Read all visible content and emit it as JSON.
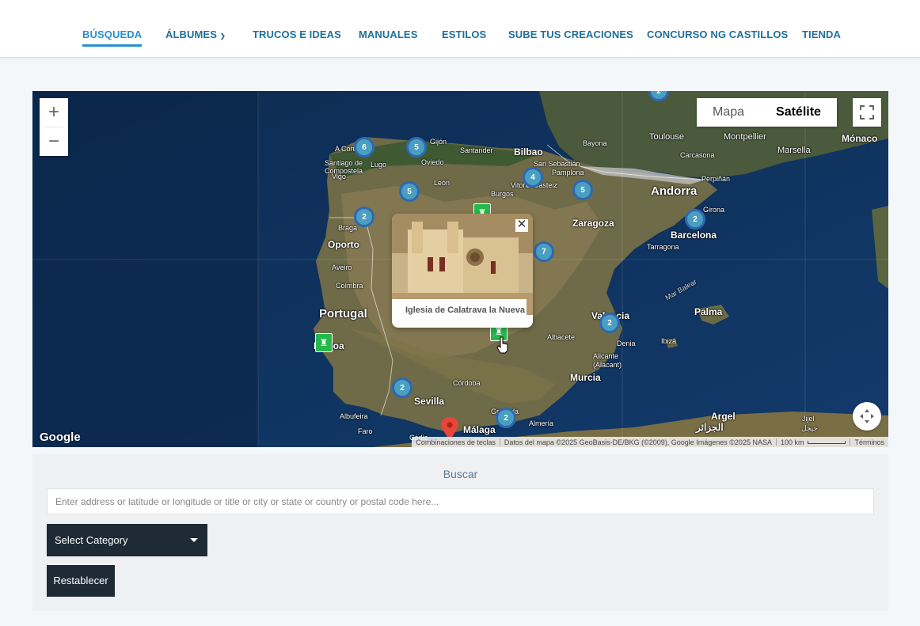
{
  "nav": {
    "items": [
      {
        "label": "BÚSQUEDA"
      },
      {
        "label": "ÁLBUMES"
      },
      {
        "label": "TRUCOS E IDEAS"
      },
      {
        "label": "MANUALES"
      },
      {
        "label": "ESTILOS"
      },
      {
        "label": "SUBE TUS CREACIONES"
      },
      {
        "label": "CONCURSO NG CASTILLOS"
      },
      {
        "label": "TIENDA"
      }
    ],
    "active": "BÚSQUEDA",
    "dropdown_icon": "chevron-down-icon"
  },
  "map": {
    "type_control": {
      "map_label": "Mapa",
      "satellite_label": "Satélite",
      "selected": "Satélite"
    },
    "zoom_in": "+",
    "zoom_out": "−",
    "google_logo": "Google",
    "attribution": {
      "shortcuts": "Combinaciones de teclas",
      "data": "Datos del mapa ©2025 GeoBasis-DE/BKG (©2009), Google Imágenes ©2025 NASA",
      "scale": "100 km",
      "terms": "Términos"
    },
    "places": [
      "Toulouse",
      "Montpellier",
      "Mónaco",
      "Carcasona",
      "Marsella",
      "Bayona",
      "Bilbao",
      "San Sebastián",
      "Pamplona",
      "Vitoria-Gasteiz",
      "Santander",
      "Gijón",
      "Oviedo",
      "A Coruña",
      "Santiago de Compostela",
      "Lugo",
      "León",
      "Burgos",
      "Vigo",
      "Braga",
      "Oporto",
      "Aveiro",
      "Coímbra",
      "Portugal",
      "Lisboa",
      "Andorra",
      "Perpiñán",
      "Girona",
      "Barcelona",
      "Tarragona",
      "Zaragoza",
      "Mar Balear",
      "Palma",
      "Valencia",
      "Albacete",
      "Denia",
      "Ibiza",
      "Alicante (Alacant)",
      "Murcia",
      "Córdoba",
      "Sevilla",
      "Albufeira",
      "Faro",
      "Cádiz",
      "Málaga",
      "Granada",
      "Almería",
      "Argel",
      "الجزائر",
      "Jijel",
      "جيجل"
    ],
    "clusters": [
      {
        "count": "2"
      },
      {
        "count": "6"
      },
      {
        "count": "5"
      },
      {
        "count": "5"
      },
      {
        "count": "4"
      },
      {
        "count": "5"
      },
      {
        "count": "2"
      },
      {
        "count": "2"
      },
      {
        "count": "7"
      },
      {
        "count": "2"
      },
      {
        "count": "2"
      },
      {
        "count": "2"
      }
    ],
    "popup": {
      "title": "Iglesia de Calatrava la Nueva",
      "close_icon": "close-icon"
    }
  },
  "search": {
    "title": "Buscar",
    "placeholder": "Enter address or latitude or longitude or title or city or state or country or postal code here...",
    "category_label": "Select Category",
    "reset_label": "Restablecer"
  },
  "colors": {
    "nav_text": "#1f6f9a",
    "nav_active": "#2a8fcf",
    "cluster": "#4a9fc0",
    "cluster_border": "#2e68b0",
    "pin": "#27b84a",
    "button_bg": "#1e2a36"
  }
}
